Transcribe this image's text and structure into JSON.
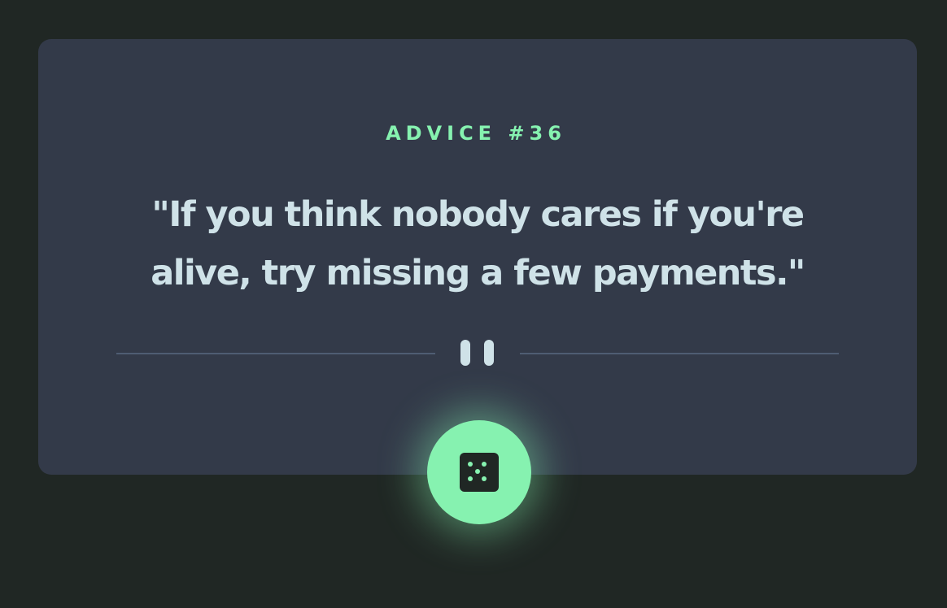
{
  "advice": {
    "heading": "ADVICE #36",
    "quote": "\"If you think nobody cares if you're alive, try missing a few payments.\""
  },
  "divider": {
    "icon": "pause-icon"
  },
  "button": {
    "icon": "dice-icon"
  },
  "colors": {
    "background": "#202724",
    "card": "#333a49",
    "accent": "#86f2b0",
    "text": "#cfe2e8",
    "divider": "#4f5d73",
    "dice": "#202724"
  }
}
